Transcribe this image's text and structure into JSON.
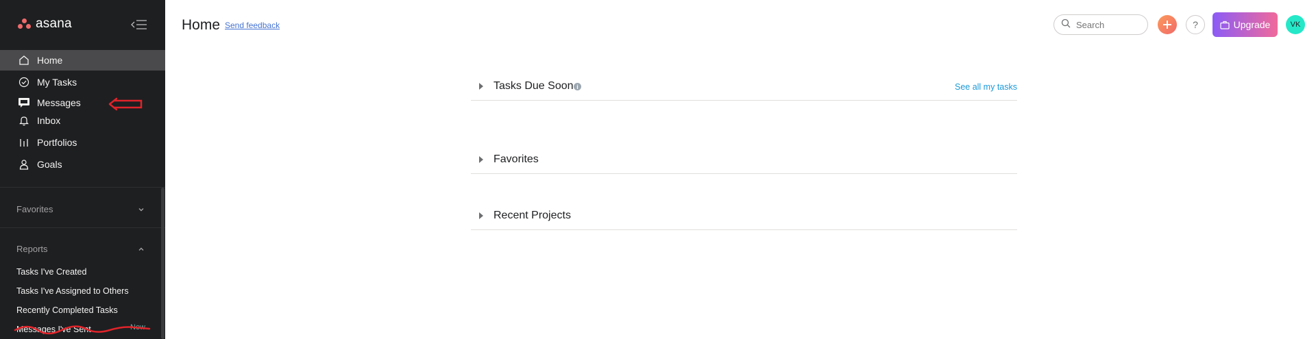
{
  "app": {
    "brand": "asana",
    "brand_color": "#f06a6a"
  },
  "sidebar": {
    "nav": [
      {
        "label": "Home",
        "icon": "home-icon",
        "active": true
      },
      {
        "label": "My Tasks",
        "icon": "check-circle-icon"
      },
      {
        "label": "Messages",
        "icon": "message-icon"
      },
      {
        "label": "Inbox",
        "icon": "bell-icon"
      },
      {
        "label": "Portfolios",
        "icon": "bars-icon"
      },
      {
        "label": "Goals",
        "icon": "person-icon"
      }
    ],
    "favorites_label": "Favorites",
    "reports_label": "Reports",
    "reports": [
      "Tasks I've Created",
      "Tasks I've Assigned to Others",
      "Recently Completed Tasks",
      "Messages I've Sent"
    ],
    "new_badge": "New"
  },
  "header": {
    "title": "Home",
    "feedback": "Send feedback",
    "search_placeholder": "Search",
    "help": "?",
    "upgrade": "Upgrade",
    "avatar_initials": "VK",
    "avatar_color": "#25e8c8"
  },
  "main": {
    "sections": [
      {
        "label": "Tasks Due Soon",
        "has_info": true,
        "link": "See all my tasks"
      },
      {
        "label": "Favorites"
      },
      {
        "label": "Recent Projects"
      }
    ]
  }
}
